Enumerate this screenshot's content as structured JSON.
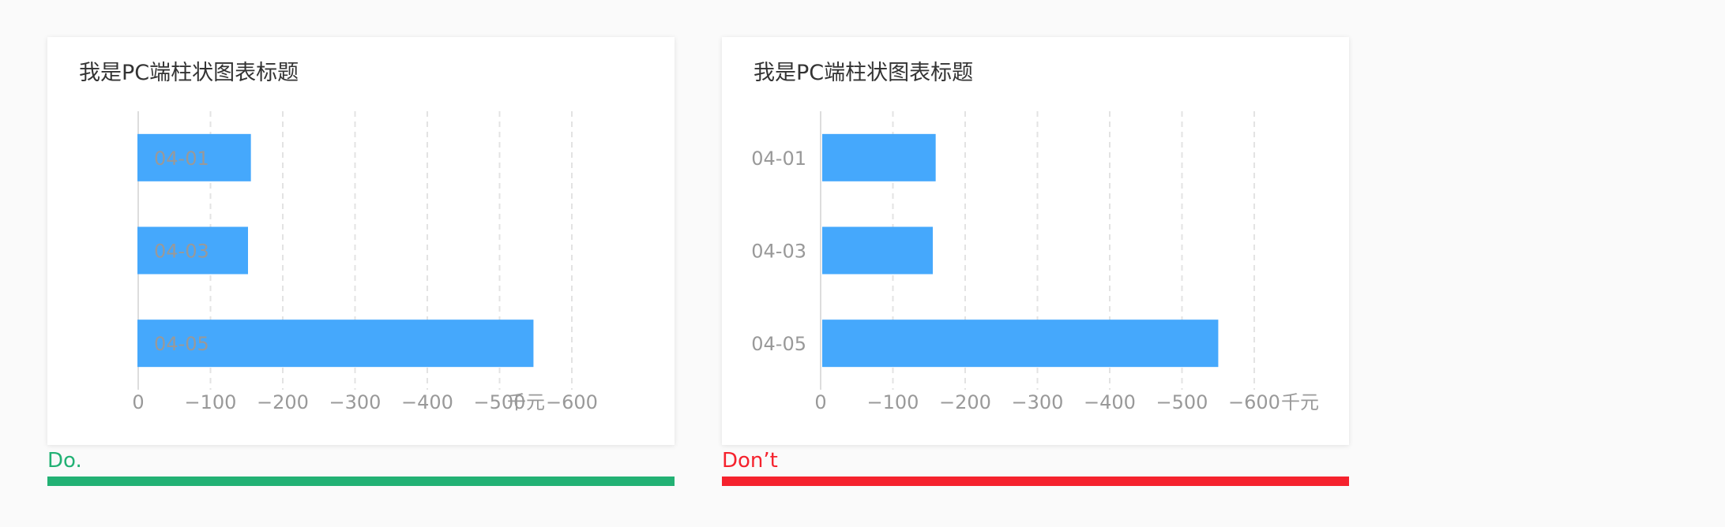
{
  "colors": {
    "bar": "#45a8fc",
    "grid": "#e3e3e3",
    "axis": "#dddddd",
    "tick_text": "#999999",
    "do": "#22b174",
    "dont": "#f5222d"
  },
  "panels": [
    {
      "verdict": "Do.",
      "verdict_color": "#22b174",
      "chart_data": {
        "type": "bar",
        "orientation": "horizontal",
        "title": "我是PC端柱状图表标题",
        "categories": [
          "04-01",
          "04-03",
          "04-05"
        ],
        "values": [
          -157,
          -153,
          -548
        ],
        "xlim": [
          -600,
          0
        ],
        "xticks": [
          -600,
          -500,
          -400,
          -300,
          -200,
          -100,
          0
        ],
        "xtick_labels": [
          "−600",
          "−500",
          "−400",
          "−300",
          "−200",
          "−100",
          "0"
        ],
        "unit": "千元",
        "grid": true,
        "category_axis_side": "right"
      }
    },
    {
      "verdict": "Don’t",
      "verdict_color": "#f5222d",
      "chart_data": {
        "type": "bar",
        "orientation": "horizontal",
        "title": "我是PC端柱状图表标题",
        "categories": [
          "04-01",
          "04-03",
          "04-05"
        ],
        "values": [
          -157,
          -153,
          -548
        ],
        "xlim": [
          0,
          -600
        ],
        "xticks": [
          0,
          -100,
          -200,
          -300,
          -400,
          -500,
          -600
        ],
        "xtick_labels": [
          "0",
          "−100",
          "−200",
          "−300",
          "−400",
          "−500",
          "−600"
        ],
        "unit": "千元",
        "grid": true,
        "category_axis_side": "left"
      }
    }
  ]
}
